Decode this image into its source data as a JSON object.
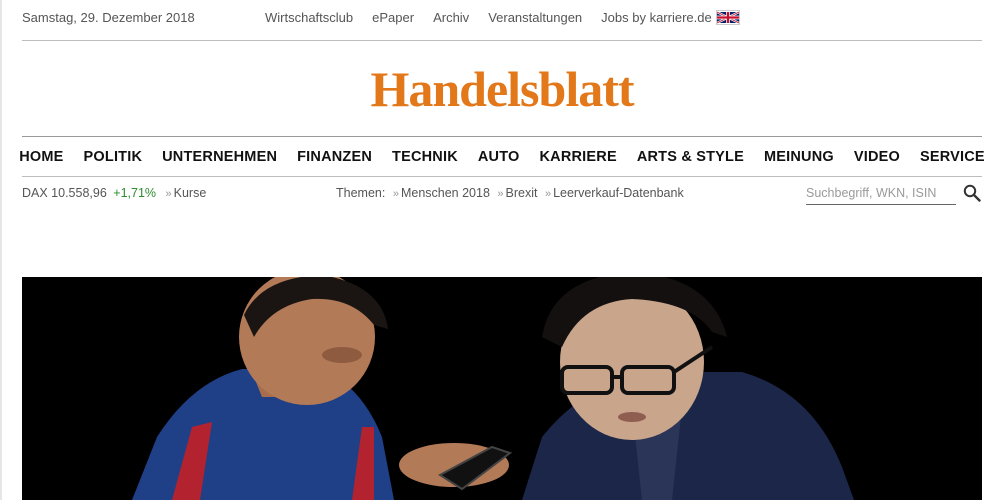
{
  "header": {
    "date": "Samstag, 29. Dezember 2018",
    "links": [
      "Wirtschaftsclub",
      "ePaper",
      "Archiv",
      "Veranstaltungen",
      "Jobs by karriere.de"
    ],
    "language_icon": "uk-flag-icon"
  },
  "logo": {
    "text": "Handelsblatt",
    "color": "#e2781a"
  },
  "nav": {
    "items": [
      "HOME",
      "POLITIK",
      "UNTERNEHMEN",
      "FINANZEN",
      "TECHNIK",
      "AUTO",
      "KARRIERE",
      "ARTS & STYLE",
      "MEINUNG",
      "VIDEO",
      "SERVICE"
    ]
  },
  "ticker": {
    "index": "DAX 10.558,96",
    "change": "+1,71%",
    "change_color": "#2e8b2e",
    "link": "Kurse"
  },
  "themes": {
    "label": "Themen:",
    "items": [
      "Menschen 2018",
      "Brexit",
      "Leerverkauf-Datenbank"
    ]
  },
  "search": {
    "placeholder": "Suchbegriff, WKN, ISIN",
    "value": "",
    "icon": "search-icon"
  },
  "hero": {
    "image": "photo-two-men-looking-at-smartphone"
  }
}
